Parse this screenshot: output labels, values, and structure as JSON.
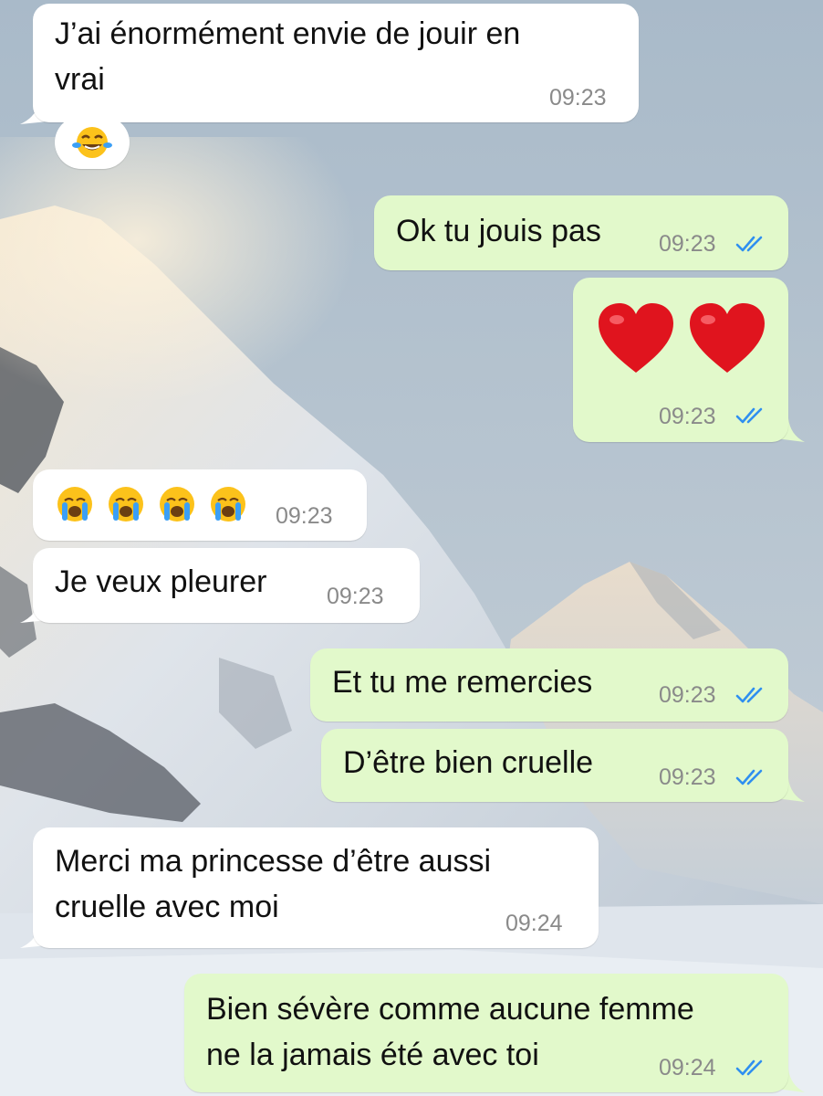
{
  "colors": {
    "incoming_bubble": "#ffffff",
    "outgoing_bubble": "#e2f9cb",
    "timestamp": "#8a8a8a",
    "read_ticks": "#2f8ff0"
  },
  "messages": [
    {
      "direction": "in",
      "text": "J’ai énormément envie de jouir en\nvrai",
      "time": "09:23"
    },
    {
      "direction": "in",
      "kind": "reaction",
      "emoji_name": "face-with-tears-of-joy-icon"
    },
    {
      "direction": "out",
      "text": "Ok tu jouis pas",
      "time": "09:23",
      "status_icon": "double-check-read-icon"
    },
    {
      "direction": "out",
      "kind": "emoji",
      "emoji_names": [
        "red-heart-icon",
        "red-heart-icon"
      ],
      "time": "09:23",
      "status_icon": "double-check-read-icon"
    },
    {
      "direction": "in",
      "kind": "emoji",
      "emoji_names": [
        "loudly-crying-face-icon",
        "loudly-crying-face-icon",
        "loudly-crying-face-icon",
        "loudly-crying-face-icon"
      ],
      "time": "09:23"
    },
    {
      "direction": "in",
      "text": "Je veux pleurer",
      "time": "09:23"
    },
    {
      "direction": "out",
      "text": "Et tu me remercies",
      "time": "09:23",
      "status_icon": "double-check-read-icon"
    },
    {
      "direction": "out",
      "text": "D’être bien cruelle",
      "time": "09:23",
      "status_icon": "double-check-read-icon"
    },
    {
      "direction": "in",
      "text": "Merci ma princesse d’être aussi\ncruelle avec moi",
      "time": "09:24"
    },
    {
      "direction": "out",
      "text": "Bien sévère comme aucune femme\nne la jamais été avec toi",
      "time": "09:24",
      "status_icon": "double-check-read-icon"
    }
  ]
}
